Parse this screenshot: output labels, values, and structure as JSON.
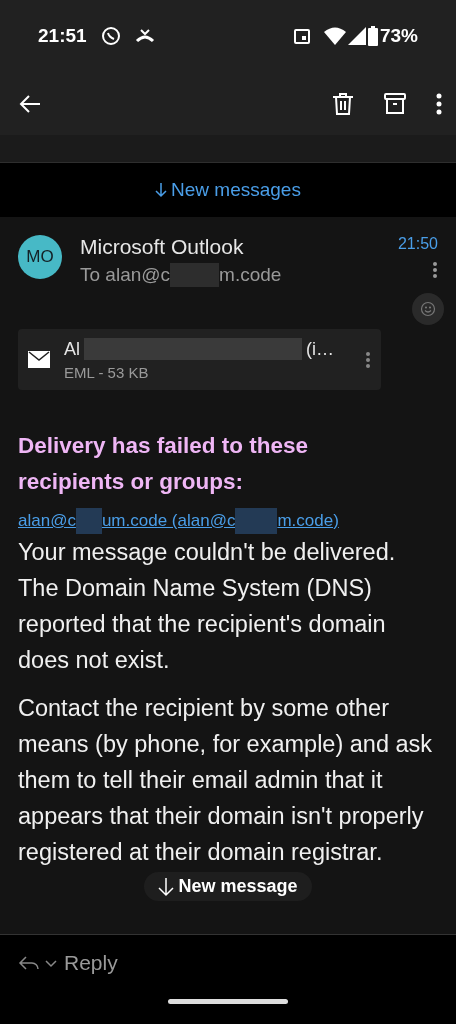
{
  "status_bar": {
    "time": "21:51",
    "battery": "73%"
  },
  "new_messages_banner": {
    "label": "New messages"
  },
  "message": {
    "avatar": "MO",
    "sender": "Microsoft Outlook",
    "to_prefix": "To alan@c",
    "to_suffix": "m.code",
    "time": "21:50",
    "attachment": {
      "name_prefix": "Al",
      "name_suffix": "(i…",
      "meta": "EML - 53 KB"
    },
    "heading": "Delivery has failed to these recipients or groups:",
    "recipient_link": {
      "part_1": "alan@c",
      "part_2": "um.code (alan@c",
      "part_3": "m.code)"
    },
    "paragraphs": [
      "Your message couldn't be delivered. The Domain Name System (DNS) reported that the recipient's domain does not exist.",
      "Contact the recipient by some other means (by phone, for example) and ask them to tell their email admin that it appears that their domain isn't properly registered at their domain registrar."
    ]
  },
  "new_message_pill": {
    "label": "New message"
  },
  "reply_bar": {
    "label": "Reply"
  }
}
